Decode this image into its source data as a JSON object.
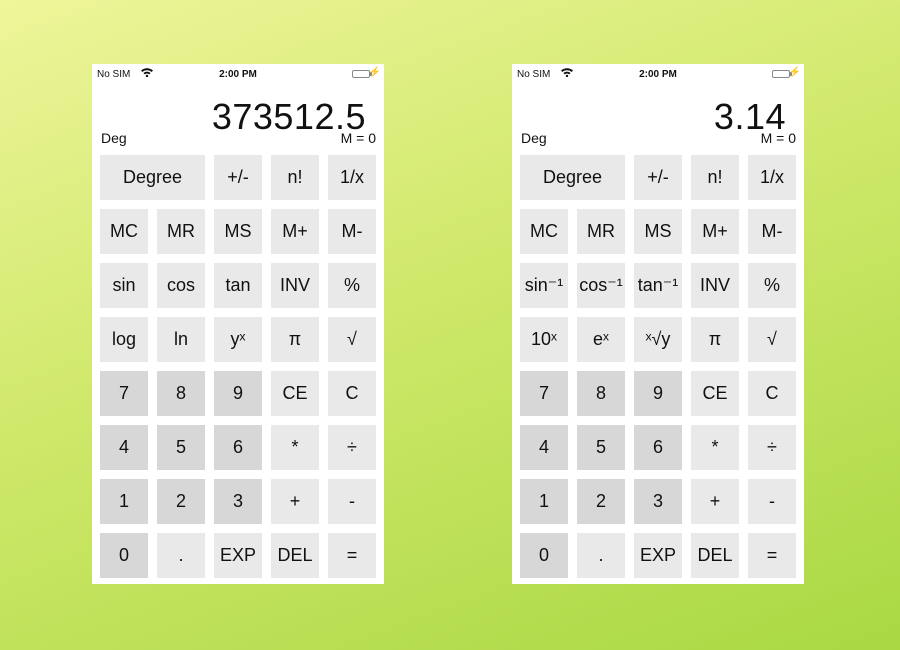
{
  "phones": [
    {
      "status": {
        "carrier": "No SIM",
        "time": "2:00 PM",
        "bolt": "⚡"
      },
      "display": {
        "value": "373512.5",
        "mode": "Deg",
        "memory": "M = 0"
      },
      "rows": [
        [
          "Degree",
          "+/-",
          "n!",
          "1/x"
        ],
        [
          "MC",
          "MR",
          "MS",
          "M+",
          "M-"
        ],
        [
          "sin",
          "cos",
          "tan",
          "INV",
          "%"
        ],
        [
          "log",
          "ln",
          "yˣ",
          "π",
          "√"
        ],
        [
          "7",
          "8",
          "9",
          "CE",
          "C"
        ],
        [
          "4",
          "5",
          "6",
          "*",
          "÷"
        ],
        [
          "1",
          "2",
          "3",
          "+",
          "-"
        ],
        [
          "0",
          ".",
          "EXP",
          "DEL",
          "="
        ]
      ]
    },
    {
      "status": {
        "carrier": "No SIM",
        "time": "2:00 PM",
        "bolt": "⚡"
      },
      "display": {
        "value": "3.14",
        "mode": "Deg",
        "memory": "M = 0"
      },
      "rows": [
        [
          "Degree",
          "+/-",
          "n!",
          "1/x"
        ],
        [
          "MC",
          "MR",
          "MS",
          "M+",
          "M-"
        ],
        [
          "sin⁻¹",
          "cos⁻¹",
          "tan⁻¹",
          "INV",
          "%"
        ],
        [
          "10ˣ",
          "eˣ",
          "ˣ√y",
          "π",
          "√"
        ],
        [
          "7",
          "8",
          "9",
          "CE",
          "C"
        ],
        [
          "4",
          "5",
          "6",
          "*",
          "÷"
        ],
        [
          "1",
          "2",
          "3",
          "+",
          "-"
        ],
        [
          "0",
          ".",
          "EXP",
          "DEL",
          "="
        ]
      ]
    }
  ],
  "colors": {
    "key_bg": "#e9e9e9",
    "digit_bg": "#d7d7d7",
    "battery": "#4cd964"
  }
}
